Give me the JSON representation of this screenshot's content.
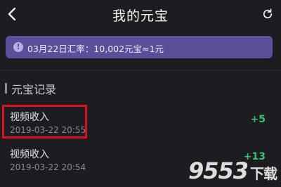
{
  "header": {
    "title": "我的元宝",
    "back_icon": "chevron-left-icon",
    "refresh_icon": "refresh-icon"
  },
  "banner": {
    "icon": "info-icon",
    "text": "03月22日汇率：10,002元宝≈1元"
  },
  "section": {
    "title": "元宝记录"
  },
  "records": [
    {
      "name": "视频收入",
      "time": "2019-03-22 20:55",
      "amount": "+5"
    },
    {
      "name": "视频收入",
      "time": "2019-03-22 20:54",
      "amount": "+13"
    }
  ],
  "watermark": {
    "text": "9553",
    "suffix": "下载"
  },
  "colors": {
    "background": "#1d1d21",
    "banner": "#5b4f99",
    "amount_green": "#35c46b",
    "highlight_red": "#d8131b"
  }
}
